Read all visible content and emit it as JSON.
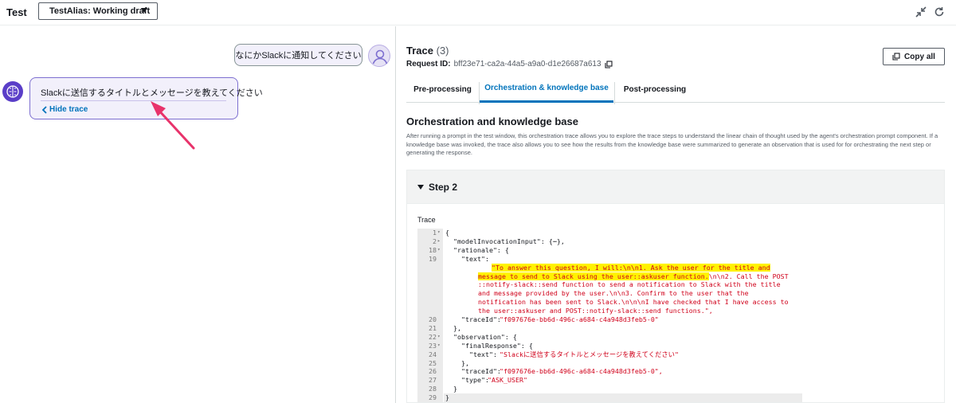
{
  "header": {
    "title": "Test",
    "alias_select": "TestAlias: Working draft"
  },
  "chat": {
    "user_message": "なにかSlackに通知してください",
    "agent_message": "Slackに送信するタイトルとメッセージを教えてください",
    "hide_trace": "Hide trace"
  },
  "trace": {
    "title": "Trace",
    "count": "(3)",
    "request_id_label": "Request ID:",
    "request_id": "bff23e71-ca2a-44a5-a9a0-d1e26687a613",
    "copy_all": "Copy all",
    "tabs": [
      "Pre-processing",
      "Orchestration & knowledge base",
      "Post-processing"
    ],
    "active_tab": "Orchestration & knowledge base",
    "section_title": "Orchestration and knowledge base",
    "section_desc": "After running a prompt in the test window, this orchestration trace allows you to explore the trace steps to understand the linear chain of thought used by the agent's orchestration prompt component. If a knowledge base was invoked, the trace also allows you to see how the results from the knowledge base were summarized to generate an observation that is used for for orchestrating the next step or generating the response.",
    "step_label": "Step 2",
    "trace_label": "Trace"
  },
  "code_lines": [
    {
      "n": "1",
      "fold": "▾",
      "t": "{"
    },
    {
      "n": "2",
      "fold": "▸",
      "t": "  \"modelInvocationInput\": {⋯},"
    },
    {
      "n": "18",
      "fold": "▾",
      "t": "  \"rationale\": {"
    },
    {
      "n": "19",
      "fold": "",
      "t": "    \"text\": "
    },
    {
      "n": "",
      "fold": "",
      "t": ""
    },
    {
      "n": "",
      "fold": "",
      "t": ""
    },
    {
      "n": "",
      "fold": "",
      "t": ""
    },
    {
      "n": "",
      "fold": "",
      "t": ""
    },
    {
      "n": "",
      "fold": "",
      "t": ""
    },
    {
      "n": "",
      "fold": "",
      "t": ""
    },
    {
      "n": "20",
      "fold": "",
      "t": "    \"traceId\": "
    },
    {
      "n": "21",
      "fold": "",
      "t": "  },"
    },
    {
      "n": "22",
      "fold": "▾",
      "t": "  \"observation\": {"
    },
    {
      "n": "23",
      "fold": "▾",
      "t": "    \"finalResponse\": {"
    },
    {
      "n": "24",
      "fold": "",
      "t": "      \"text\": "
    },
    {
      "n": "25",
      "fold": "",
      "t": "    },"
    },
    {
      "n": "26",
      "fold": "",
      "t": "    \"traceId\": "
    },
    {
      "n": "27",
      "fold": "",
      "t": "    \"type\": "
    },
    {
      "n": "28",
      "fold": "",
      "t": "  }"
    },
    {
      "n": "29",
      "fold": "",
      "t": "}"
    }
  ],
  "code_strings": {
    "rationale_1a": "\"To answer this question, I will:\\n\\n1. Ask the user for the title and",
    "rationale_2a": "message to send to Slack using the user::askuser function.",
    "rationale_2b": "\\n\\n2. Call the POST",
    "rationale_3": "::notify-slack::send function to send a notification to Slack with the title",
    "rationale_4": "and message provided by the user.\\n\\n3. Confirm to the user that the",
    "rationale_5": "notification has been sent to Slack.\\n\\n\\nI have checked that I have access to",
    "rationale_6": "the user::askuser and POST::notify-slack::send functions.\",",
    "trace_id": "\"f097676e-bb6d-496c-a684-c4a948d3feb5-0\"",
    "final_text": "\"Slackに送信するタイトルとメッセージを教えてください\"",
    "obs_trace_id": "\"f097676e-bb6d-496c-a684-c4a948d3feb5-0\",",
    "type": "\"ASK_USER\""
  },
  "colors": {
    "accent": "#0073bb",
    "bubble_border": "#7d6fd0",
    "annotation_arrow": "#e8336b",
    "string": "#d0021b",
    "highlight": "#fff200"
  }
}
